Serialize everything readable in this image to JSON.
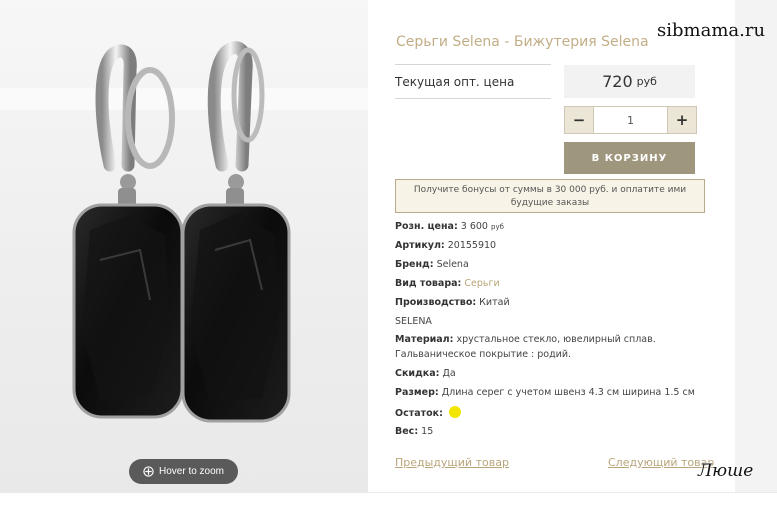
{
  "product": {
    "title": "Серьги Selena - Бижутерия Selena",
    "image_alt": "black crystal earrings"
  },
  "watermark": "sibmama.ru",
  "signature": "Люше",
  "zoom": {
    "label": "Hover to zoom",
    "icon": "zoom-icon"
  },
  "price": {
    "label": "Текущая опт. цена",
    "value": "720",
    "currency": "руб"
  },
  "quantity": {
    "minus": "−",
    "value": "1",
    "plus": "+"
  },
  "cart_button": "В КОРЗИНУ",
  "bonus_text": "Получите бонусы от суммы в 30 000 руб. и оплатите ими будущие заказы",
  "specs": {
    "retail_label": "Розн. цена:",
    "retail_value": "3 600",
    "retail_cur": "руб",
    "sku_label": "Артикул:",
    "sku_value": "20155910",
    "brand_label": "Бренд:",
    "brand_value": "Selena",
    "type_label": "Вид товара:",
    "type_value": "Серьги",
    "origin_label": "Производство:",
    "origin_value": "Китай",
    "brand_line": "SELENA",
    "material_label": "Материал:",
    "material_value": "хрустальное стекло, ювелирный сплав.",
    "material_line2": "Гальваническое покрытие : родий.",
    "discount_label": "Скидка:",
    "discount_value": "Да",
    "size_label": "Размер:",
    "size_value": "Длина серег с учетом швенз 4.3 см ширина 1.5 см",
    "stock_label": "Остаток:",
    "stock_color": "#f2e600",
    "weight_label": "Вес:",
    "weight_value": "15"
  },
  "nav": {
    "prev": "Предыдущий товар",
    "next": "Следующий товар"
  },
  "colors": {
    "accent": "#c2ae86",
    "cart": "#9f967e",
    "link": "#b9a57a"
  }
}
